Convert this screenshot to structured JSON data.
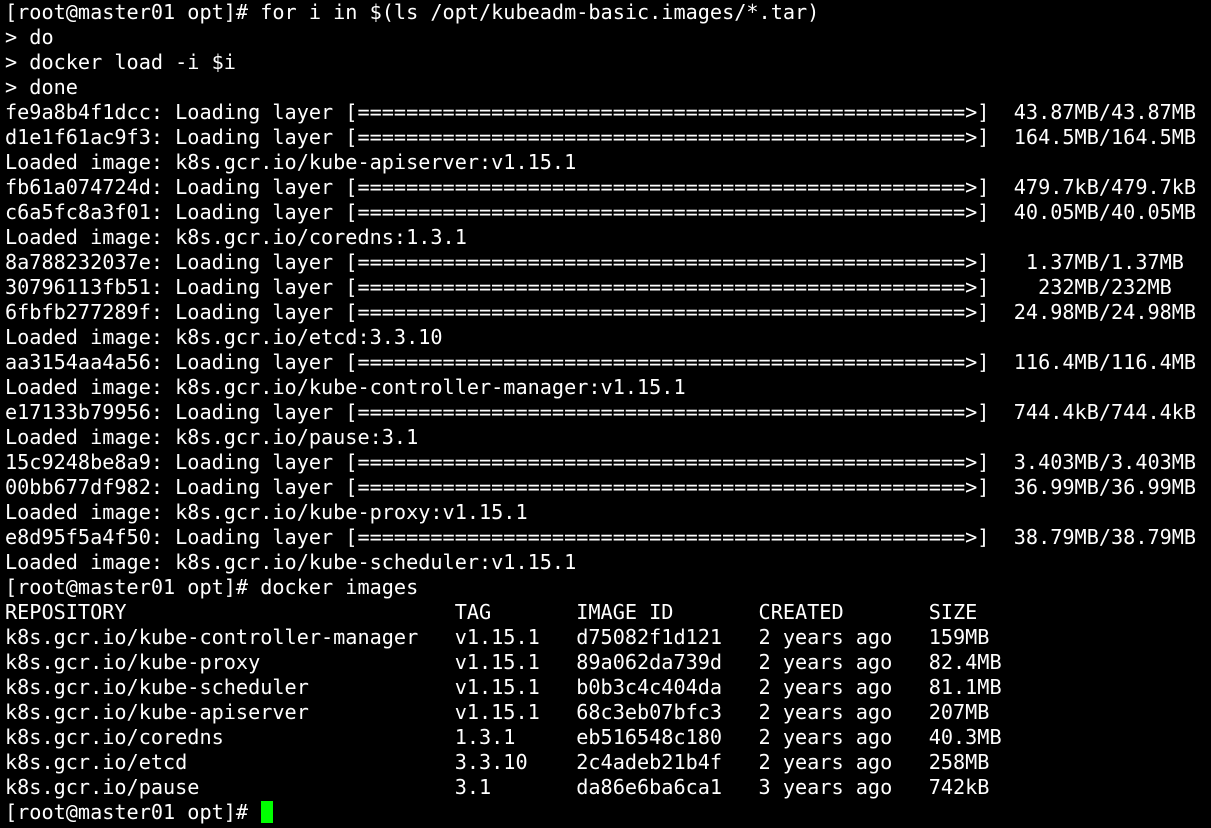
{
  "terminal": {
    "cursor_color": "#00ff00",
    "lines": [
      "[root@master01 opt]# for i in $(ls /opt/kubeadm-basic.images/*.tar)",
      "> do",
      "> docker load -i $i",
      "> done",
      "fe9a8b4f1dcc: Loading layer [==================================================>]  43.87MB/43.87MB",
      "d1e1f61ac9f3: Loading layer [==================================================>]  164.5MB/164.5MB",
      "Loaded image: k8s.gcr.io/kube-apiserver:v1.15.1",
      "fb61a074724d: Loading layer [==================================================>]  479.7kB/479.7kB",
      "c6a5fc8a3f01: Loading layer [==================================================>]  40.05MB/40.05MB",
      "Loaded image: k8s.gcr.io/coredns:1.3.1",
      "8a788232037e: Loading layer [==================================================>]   1.37MB/1.37MB",
      "30796113fb51: Loading layer [==================================================>]    232MB/232MB",
      "6fbfb277289f: Loading layer [==================================================>]  24.98MB/24.98MB",
      "Loaded image: k8s.gcr.io/etcd:3.3.10",
      "aa3154aa4a56: Loading layer [==================================================>]  116.4MB/116.4MB",
      "Loaded image: k8s.gcr.io/kube-controller-manager:v1.15.1",
      "e17133b79956: Loading layer [==================================================>]  744.4kB/744.4kB",
      "Loaded image: k8s.gcr.io/pause:3.1",
      "15c9248be8a9: Loading layer [==================================================>]  3.403MB/3.403MB",
      "00bb677df982: Loading layer [==================================================>]  36.99MB/36.99MB",
      "Loaded image: k8s.gcr.io/kube-proxy:v1.15.1",
      "e8d95f5a4f50: Loading layer [==================================================>]  38.79MB/38.79MB",
      "Loaded image: k8s.gcr.io/kube-scheduler:v1.15.1",
      "[root@master01 opt]# docker images",
      "REPOSITORY                           TAG       IMAGE ID       CREATED       SIZE",
      "k8s.gcr.io/kube-controller-manager   v1.15.1   d75082f1d121   2 years ago   159MB",
      "k8s.gcr.io/kube-proxy                v1.15.1   89a062da739d   2 years ago   82.4MB",
      "k8s.gcr.io/kube-scheduler            v1.15.1   b0b3c4c404da   2 years ago   81.1MB",
      "k8s.gcr.io/kube-apiserver            v1.15.1   68c3eb07bfc3   2 years ago   207MB",
      "k8s.gcr.io/coredns                   1.3.1     eb516548c180   2 years ago   40.3MB",
      "k8s.gcr.io/etcd                      3.3.10    2c4adeb21b4f   2 years ago   258MB",
      "k8s.gcr.io/pause                     3.1       da86e6ba6ca1   3 years ago   742kB"
    ],
    "prompt": "[root@master01 opt]# "
  }
}
